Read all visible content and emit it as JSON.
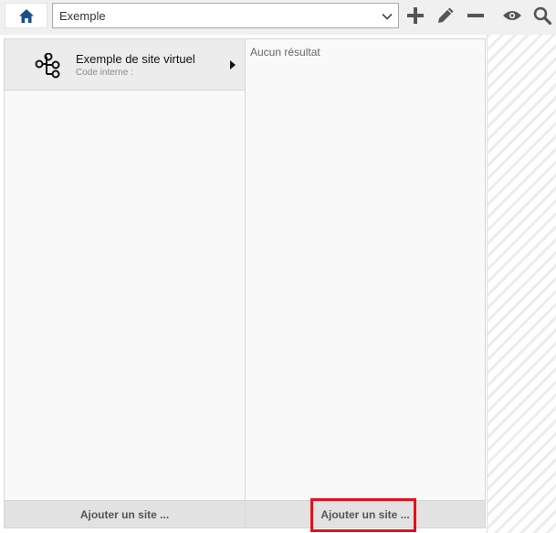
{
  "toolbar": {
    "selected_value": "Exemple",
    "icons": {
      "home": "home-icon",
      "add": "plus-icon",
      "edit": "pencil-icon",
      "remove": "minus-icon",
      "view": "eye-icon",
      "search": "search-icon"
    }
  },
  "left_column": {
    "items": [
      {
        "name": "Exemple de site virtuel",
        "sub": "Code interne :"
      }
    ],
    "add_label": "Ajouter un site ..."
  },
  "right_column": {
    "empty_text": "Aucun résultat",
    "add_label": "Ajouter un site ..."
  },
  "colors": {
    "accent": "#1a4f8b",
    "highlight": "#e3111c",
    "icon": "#555555"
  }
}
